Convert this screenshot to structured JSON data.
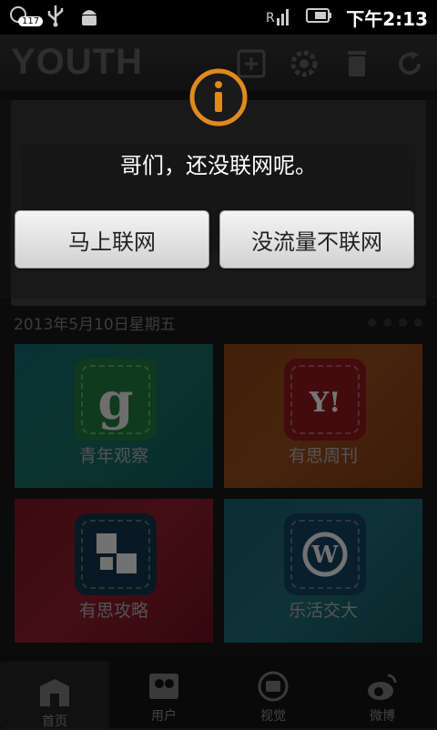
{
  "status_bar": {
    "notification_count": "117",
    "time": "下午2:13",
    "icons": [
      "notification-icon",
      "usb-icon",
      "android-debug-icon",
      "signal-icon",
      "battery-icon"
    ]
  },
  "app_header": {
    "logo": "YOUTH",
    "icons": [
      "add-icon",
      "settings-icon",
      "delete-icon",
      "refresh-icon"
    ]
  },
  "date_row": {
    "date": "2013年5月10日星期五"
  },
  "tiles": [
    {
      "label": "青年观察",
      "icon": "youth-observation-icon",
      "color": "#145f57"
    },
    {
      "label": "有思周刊",
      "icon": "yahoo-icon",
      "color": "#83401a"
    },
    {
      "label": "有思攻略",
      "icon": "puzzle-icon",
      "color": "#7a1a25"
    },
    {
      "label": "乐活交大",
      "icon": "wordpress-icon",
      "color": "#1b5d65"
    }
  ],
  "bottom_nav": [
    {
      "label": "首页",
      "icon": "home-icon"
    },
    {
      "label": "用户",
      "icon": "users-icon"
    },
    {
      "label": "视觉",
      "icon": "camera-icon"
    },
    {
      "label": "微博",
      "icon": "weibo-icon"
    }
  ],
  "dialog": {
    "message": "哥们，还没联网呢。",
    "connect_button": "马上联网",
    "no_connect_button": "没流量不联网",
    "icon": "info-icon",
    "accent": "#e08a1e"
  }
}
